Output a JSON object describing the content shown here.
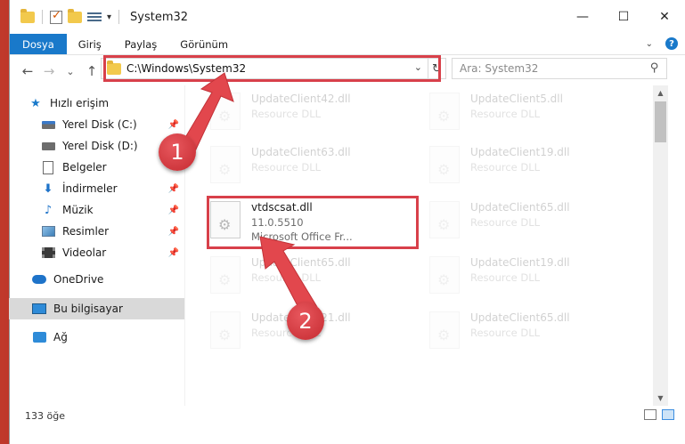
{
  "window": {
    "title": "System32",
    "controls": {
      "minimize": "—",
      "maximize": "☐",
      "close": "✕"
    }
  },
  "ribbon": {
    "tabs": [
      "Dosya",
      "Giriş",
      "Paylaş",
      "Görünüm"
    ],
    "help": "?"
  },
  "navigation": {
    "back": "←",
    "forward": "→",
    "recent": "⌄",
    "up": "↑",
    "address": "C:\\Windows\\System32",
    "refresh": "↻",
    "search_placeholder": "Ara: System32"
  },
  "sidebar": {
    "quick_access": "Hızlı erişim",
    "items": [
      {
        "label": "Yerel Disk (C:)",
        "icon": "disk-c-icon",
        "pinned": true
      },
      {
        "label": "Yerel Disk (D:)",
        "icon": "disk-d-icon",
        "pinned": false
      },
      {
        "label": "Belgeler",
        "icon": "document-icon",
        "pinned": false
      },
      {
        "label": "İndirmeler",
        "icon": "download-icon",
        "pinned": true
      },
      {
        "label": "Müzik",
        "icon": "music-icon",
        "pinned": true
      },
      {
        "label": "Resimler",
        "icon": "pictures-icon",
        "pinned": true
      },
      {
        "label": "Videolar",
        "icon": "videos-icon",
        "pinned": true
      }
    ],
    "onedrive": "OneDrive",
    "this_pc": "Bu bilgisayar",
    "network": "Ağ"
  },
  "files": [
    {
      "name": "UpdateClient42.dll",
      "line2": "Resource DLL",
      "line3": "",
      "faded": true
    },
    {
      "name": "UpdateClient5.dll",
      "line2": "Resource DLL",
      "line3": "",
      "faded": true
    },
    {
      "name": "UpdateClient63.dll",
      "line2": "Resource DLL",
      "line3": "",
      "faded": true
    },
    {
      "name": "UpdateClient19.dll",
      "line2": "Resource DLL",
      "line3": "",
      "faded": true
    },
    {
      "name": "vtdscsat.dll",
      "line2": "11.0.5510",
      "line3": "Microsoft Office Fr...",
      "faded": false
    },
    {
      "name": "UpdateClient65.dll",
      "line2": "Resource DLL",
      "line3": "",
      "faded": true
    },
    {
      "name": "UpdateClient65.dll",
      "line2": "Resource DLL",
      "line3": "",
      "faded": true
    },
    {
      "name": "UpdateClient19.dll",
      "line2": "Resource DLL",
      "line3": "",
      "faded": true
    },
    {
      "name": "UpdateClient21.dll",
      "line2": "Resource DLL",
      "line3": "",
      "faded": true
    },
    {
      "name": "UpdateClient65.dll",
      "line2": "Resource DLL",
      "line3": "",
      "faded": true
    }
  ],
  "status": {
    "count": "133 öğe"
  },
  "callouts": [
    "1",
    "2"
  ],
  "colors": {
    "accent": "#1979ca",
    "highlight": "#d8404a",
    "background": "#8e1b1b"
  }
}
